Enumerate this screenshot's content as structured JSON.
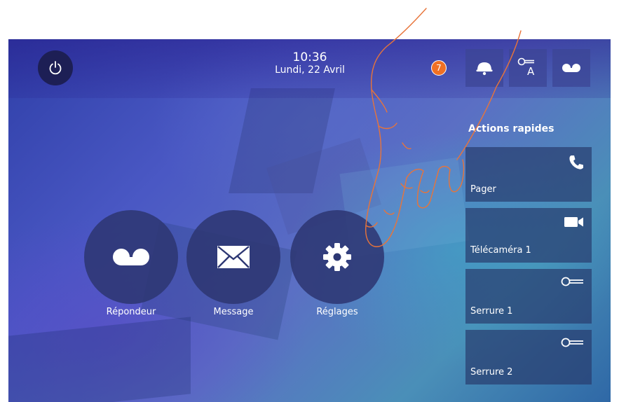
{
  "status_bar": {
    "time": "10:36",
    "date": "Lundi, 22 Avril",
    "notification_count": "7"
  },
  "top_buttons": [
    {
      "icon": "bell-icon"
    },
    {
      "icon": "key-a-icon",
      "letter": "A"
    },
    {
      "icon": "voicemail-icon"
    }
  ],
  "quick_actions": {
    "title": "Actions rapides",
    "items": [
      {
        "label": "Pager",
        "icon": "phone-icon"
      },
      {
        "label": "Télécaméra 1",
        "icon": "video-camera-icon"
      },
      {
        "label": "Serrure 1",
        "icon": "key-icon"
      },
      {
        "label": "Serrure 2",
        "icon": "key-icon"
      }
    ]
  },
  "main_buttons": [
    {
      "label": "Répondeur",
      "icon": "voicemail-icon"
    },
    {
      "label": "Message",
      "icon": "envelope-icon"
    },
    {
      "label": "Réglages",
      "icon": "gear-icon"
    }
  ],
  "colors": {
    "accent_badge": "#f07024",
    "hand_outline": "#e8743a",
    "button_dark": "#1d1f55"
  }
}
